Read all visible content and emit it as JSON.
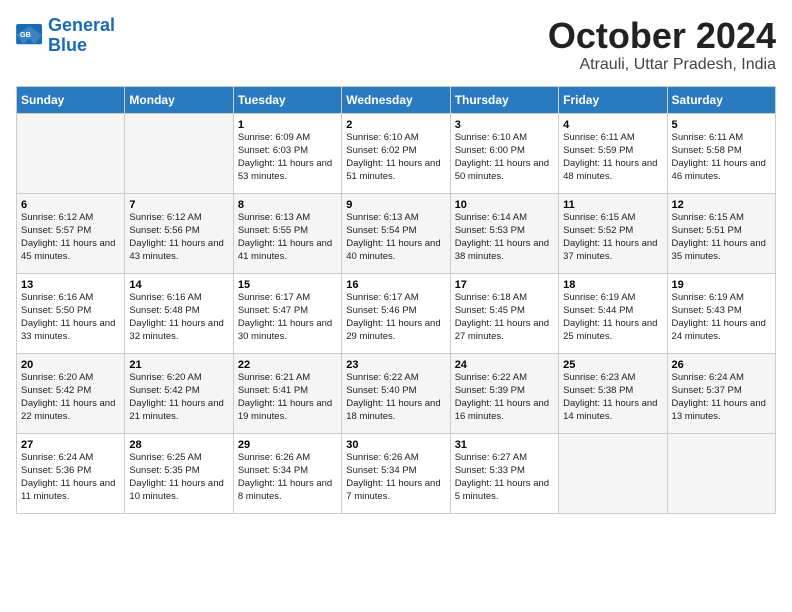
{
  "header": {
    "logo_general": "General",
    "logo_blue": "Blue",
    "month": "October 2024",
    "location": "Atrauli, Uttar Pradesh, India"
  },
  "days_of_week": [
    "Sunday",
    "Monday",
    "Tuesday",
    "Wednesday",
    "Thursday",
    "Friday",
    "Saturday"
  ],
  "weeks": [
    [
      {
        "day": "",
        "info": ""
      },
      {
        "day": "",
        "info": ""
      },
      {
        "day": "1",
        "info": "Sunrise: 6:09 AM\nSunset: 6:03 PM\nDaylight: 11 hours and 53 minutes."
      },
      {
        "day": "2",
        "info": "Sunrise: 6:10 AM\nSunset: 6:02 PM\nDaylight: 11 hours and 51 minutes."
      },
      {
        "day": "3",
        "info": "Sunrise: 6:10 AM\nSunset: 6:00 PM\nDaylight: 11 hours and 50 minutes."
      },
      {
        "day": "4",
        "info": "Sunrise: 6:11 AM\nSunset: 5:59 PM\nDaylight: 11 hours and 48 minutes."
      },
      {
        "day": "5",
        "info": "Sunrise: 6:11 AM\nSunset: 5:58 PM\nDaylight: 11 hours and 46 minutes."
      }
    ],
    [
      {
        "day": "6",
        "info": "Sunrise: 6:12 AM\nSunset: 5:57 PM\nDaylight: 11 hours and 45 minutes."
      },
      {
        "day": "7",
        "info": "Sunrise: 6:12 AM\nSunset: 5:56 PM\nDaylight: 11 hours and 43 minutes."
      },
      {
        "day": "8",
        "info": "Sunrise: 6:13 AM\nSunset: 5:55 PM\nDaylight: 11 hours and 41 minutes."
      },
      {
        "day": "9",
        "info": "Sunrise: 6:13 AM\nSunset: 5:54 PM\nDaylight: 11 hours and 40 minutes."
      },
      {
        "day": "10",
        "info": "Sunrise: 6:14 AM\nSunset: 5:53 PM\nDaylight: 11 hours and 38 minutes."
      },
      {
        "day": "11",
        "info": "Sunrise: 6:15 AM\nSunset: 5:52 PM\nDaylight: 11 hours and 37 minutes."
      },
      {
        "day": "12",
        "info": "Sunrise: 6:15 AM\nSunset: 5:51 PM\nDaylight: 11 hours and 35 minutes."
      }
    ],
    [
      {
        "day": "13",
        "info": "Sunrise: 6:16 AM\nSunset: 5:50 PM\nDaylight: 11 hours and 33 minutes."
      },
      {
        "day": "14",
        "info": "Sunrise: 6:16 AM\nSunset: 5:48 PM\nDaylight: 11 hours and 32 minutes."
      },
      {
        "day": "15",
        "info": "Sunrise: 6:17 AM\nSunset: 5:47 PM\nDaylight: 11 hours and 30 minutes."
      },
      {
        "day": "16",
        "info": "Sunrise: 6:17 AM\nSunset: 5:46 PM\nDaylight: 11 hours and 29 minutes."
      },
      {
        "day": "17",
        "info": "Sunrise: 6:18 AM\nSunset: 5:45 PM\nDaylight: 11 hours and 27 minutes."
      },
      {
        "day": "18",
        "info": "Sunrise: 6:19 AM\nSunset: 5:44 PM\nDaylight: 11 hours and 25 minutes."
      },
      {
        "day": "19",
        "info": "Sunrise: 6:19 AM\nSunset: 5:43 PM\nDaylight: 11 hours and 24 minutes."
      }
    ],
    [
      {
        "day": "20",
        "info": "Sunrise: 6:20 AM\nSunset: 5:42 PM\nDaylight: 11 hours and 22 minutes."
      },
      {
        "day": "21",
        "info": "Sunrise: 6:20 AM\nSunset: 5:42 PM\nDaylight: 11 hours and 21 minutes."
      },
      {
        "day": "22",
        "info": "Sunrise: 6:21 AM\nSunset: 5:41 PM\nDaylight: 11 hours and 19 minutes."
      },
      {
        "day": "23",
        "info": "Sunrise: 6:22 AM\nSunset: 5:40 PM\nDaylight: 11 hours and 18 minutes."
      },
      {
        "day": "24",
        "info": "Sunrise: 6:22 AM\nSunset: 5:39 PM\nDaylight: 11 hours and 16 minutes."
      },
      {
        "day": "25",
        "info": "Sunrise: 6:23 AM\nSunset: 5:38 PM\nDaylight: 11 hours and 14 minutes."
      },
      {
        "day": "26",
        "info": "Sunrise: 6:24 AM\nSunset: 5:37 PM\nDaylight: 11 hours and 13 minutes."
      }
    ],
    [
      {
        "day": "27",
        "info": "Sunrise: 6:24 AM\nSunset: 5:36 PM\nDaylight: 11 hours and 11 minutes."
      },
      {
        "day": "28",
        "info": "Sunrise: 6:25 AM\nSunset: 5:35 PM\nDaylight: 11 hours and 10 minutes."
      },
      {
        "day": "29",
        "info": "Sunrise: 6:26 AM\nSunset: 5:34 PM\nDaylight: 11 hours and 8 minutes."
      },
      {
        "day": "30",
        "info": "Sunrise: 6:26 AM\nSunset: 5:34 PM\nDaylight: 11 hours and 7 minutes."
      },
      {
        "day": "31",
        "info": "Sunrise: 6:27 AM\nSunset: 5:33 PM\nDaylight: 11 hours and 5 minutes."
      },
      {
        "day": "",
        "info": ""
      },
      {
        "day": "",
        "info": ""
      }
    ]
  ]
}
